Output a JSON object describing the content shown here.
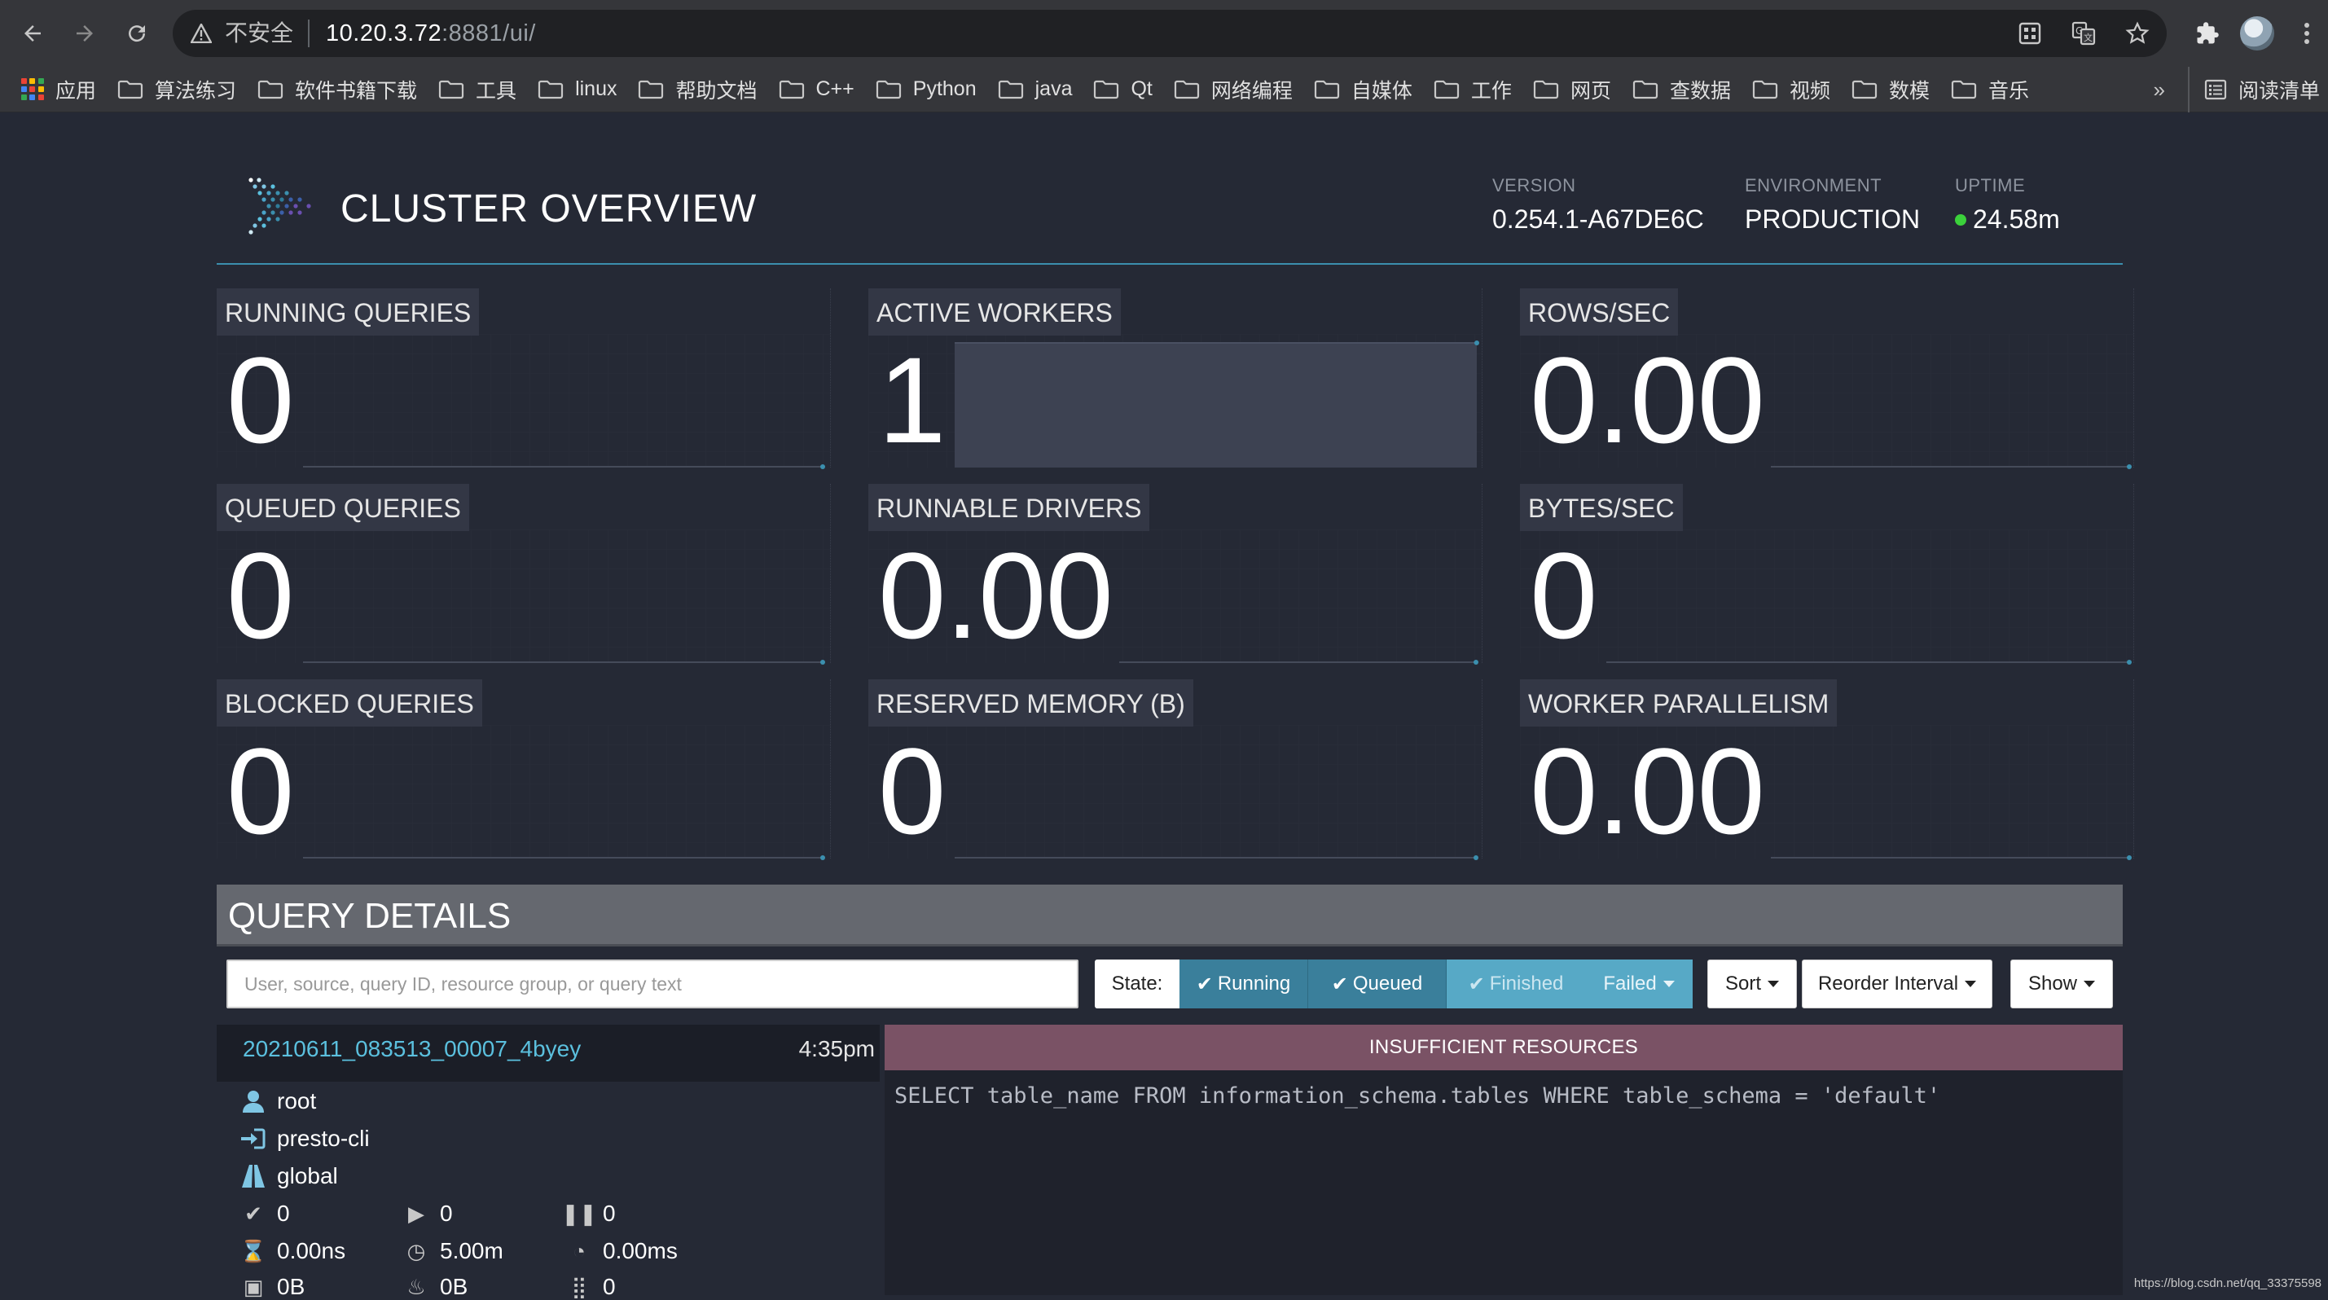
{
  "browser": {
    "insecure_label": "不安全",
    "url_host": "10.20.3.72",
    "url_rest": ":8881/ui/",
    "bookmarks": [
      "应用",
      "算法练习",
      "软件书籍下载",
      "工具",
      "linux",
      "帮助文档",
      "C++",
      "Python",
      "java",
      "Qt",
      "网络编程",
      "自媒体",
      "工作",
      "网页",
      "查数据",
      "视频",
      "数模",
      "音乐"
    ],
    "more": "»",
    "reading_list": "阅读清单"
  },
  "header": {
    "title": "CLUSTER OVERVIEW",
    "version_label": "VERSION",
    "version": "0.254.1-A67DE6C",
    "environment_label": "ENVIRONMENT",
    "environment": "PRODUCTION",
    "uptime_label": "UPTIME",
    "uptime": "24.58m",
    "uptime_color": "#3bd13b"
  },
  "stats": [
    {
      "label": "RUNNING QUERIES",
      "value": "0"
    },
    {
      "label": "ACTIVE WORKERS",
      "value": "1"
    },
    {
      "label": "ROWS/SEC",
      "value": "0.00"
    },
    {
      "label": "QUEUED QUERIES",
      "value": "0"
    },
    {
      "label": "RUNNABLE DRIVERS",
      "value": "0.00"
    },
    {
      "label": "BYTES/SEC",
      "value": "0"
    },
    {
      "label": "BLOCKED QUERIES",
      "value": "0"
    },
    {
      "label": "RESERVED MEMORY (B)",
      "value": "0"
    },
    {
      "label": "WORKER PARALLELISM",
      "value": "0.00"
    }
  ],
  "query_details": {
    "title": "QUERY DETAILS",
    "search_placeholder": "User, source, query ID, resource group, or query text",
    "state_label": "State:",
    "running": "Running",
    "queued": "Queued",
    "finished": "Finished",
    "failed": "Failed",
    "sort": "Sort",
    "reorder": "Reorder Interval",
    "show": "Show"
  },
  "query": {
    "id": "20210611_083513_00007_4byey",
    "time": "4:35pm",
    "user": "root",
    "source": "presto-cli",
    "resource_group": "global",
    "completed_splits": "0",
    "running_splits": "0",
    "queued_splits": "0",
    "wall_time": "0.00ns",
    "elapsed_time": "5.00m",
    "cpu_time": "0.00ms",
    "memory": "0B",
    "peak_memory": "0B",
    "drivers": "0",
    "status": "INSUFFICIENT RESOURCES",
    "status_color": "#7a5265",
    "sql": "SELECT table_name FROM information_schema.tables WHERE table_schema = 'default'"
  },
  "watermark": "https://blog.csdn.net/qq_33375598"
}
